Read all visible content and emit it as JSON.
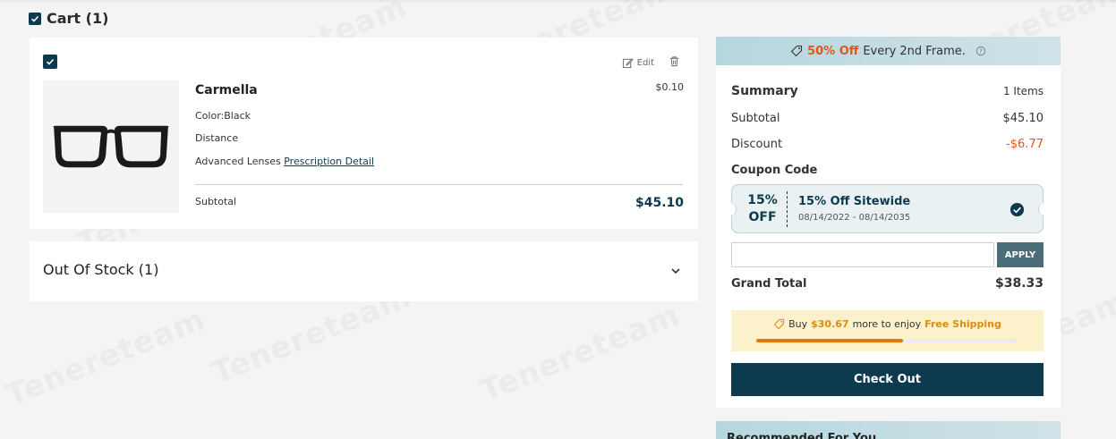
{
  "cart": {
    "title": "Cart (1)"
  },
  "item": {
    "edit_label": "Edit",
    "name": "Carmella",
    "price": "$0.10",
    "color": "Color:Black",
    "distance": "Distance",
    "lenses_label": "Advanced Lenses",
    "prescription_link": "Prescription Detail",
    "subtotal_label": "Subtotal",
    "subtotal_value": "$45.10"
  },
  "out_of_stock": {
    "label": "Out Of Stock (1)"
  },
  "promo": {
    "highlight": "50% Off",
    "text": "Every 2nd Frame."
  },
  "summary": {
    "title": "Summary",
    "items_count": "1 Items",
    "subtotal_label": "Subtotal",
    "subtotal_value": "$45.10",
    "discount_label": "Discount",
    "discount_value": "-$6.77",
    "coupon_label": "Coupon Code",
    "grand_total_label": "Grand Total",
    "grand_total_value": "$38.33"
  },
  "coupon": {
    "pct_line1": "15%",
    "pct_line2": "OFF",
    "title": "15% Off Sitewide",
    "dates": "08/14/2022 - 08/14/2035"
  },
  "code_input": {
    "value": "",
    "placeholder": ""
  },
  "apply_label": "APPLY",
  "shipping": {
    "prefix": "Buy",
    "amount": "$30.67",
    "middle": "more to enjoy",
    "free": "Free Shipping",
    "progress": 0.56
  },
  "checkout_label": "Check Out",
  "recommended": {
    "title": "Recommended For You"
  },
  "colors": {
    "accent": "#0d3a4f",
    "orange": "#e0561e",
    "progress": "#e07a10"
  }
}
